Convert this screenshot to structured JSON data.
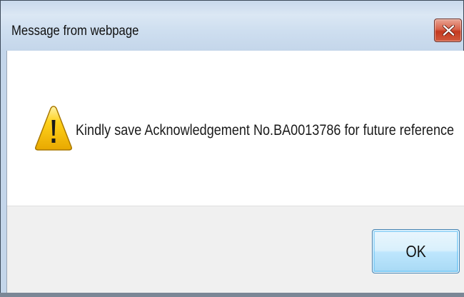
{
  "dialog": {
    "title": "Message from webpage",
    "close_icon": "close-icon",
    "warning_icon": "warning-icon",
    "message": "Kindly save Acknowledgement No.BA0013786 for future reference",
    "ok_label": "OK"
  },
  "colors": {
    "close_button": "#c7442a",
    "ok_button_border": "#3c7fb1",
    "button_area_bg": "#f0f0f0",
    "warning_yellow": "#f5c400"
  }
}
